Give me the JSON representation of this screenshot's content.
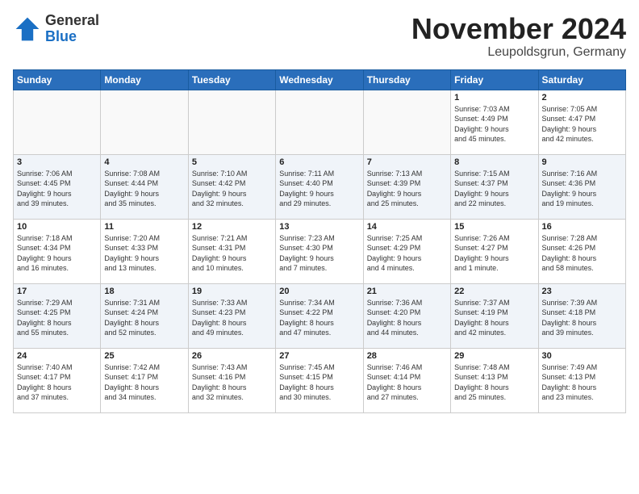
{
  "header": {
    "logo_general": "General",
    "logo_blue": "Blue",
    "month_title": "November 2024",
    "location": "Leupoldsgrun, Germany"
  },
  "calendar": {
    "days_of_week": [
      "Sunday",
      "Monday",
      "Tuesday",
      "Wednesday",
      "Thursday",
      "Friday",
      "Saturday"
    ],
    "weeks": [
      [
        {
          "day": "",
          "info": ""
        },
        {
          "day": "",
          "info": ""
        },
        {
          "day": "",
          "info": ""
        },
        {
          "day": "",
          "info": ""
        },
        {
          "day": "",
          "info": ""
        },
        {
          "day": "1",
          "info": "Sunrise: 7:03 AM\nSunset: 4:49 PM\nDaylight: 9 hours\nand 45 minutes."
        },
        {
          "day": "2",
          "info": "Sunrise: 7:05 AM\nSunset: 4:47 PM\nDaylight: 9 hours\nand 42 minutes."
        }
      ],
      [
        {
          "day": "3",
          "info": "Sunrise: 7:06 AM\nSunset: 4:45 PM\nDaylight: 9 hours\nand 39 minutes."
        },
        {
          "day": "4",
          "info": "Sunrise: 7:08 AM\nSunset: 4:44 PM\nDaylight: 9 hours\nand 35 minutes."
        },
        {
          "day": "5",
          "info": "Sunrise: 7:10 AM\nSunset: 4:42 PM\nDaylight: 9 hours\nand 32 minutes."
        },
        {
          "day": "6",
          "info": "Sunrise: 7:11 AM\nSunset: 4:40 PM\nDaylight: 9 hours\nand 29 minutes."
        },
        {
          "day": "7",
          "info": "Sunrise: 7:13 AM\nSunset: 4:39 PM\nDaylight: 9 hours\nand 25 minutes."
        },
        {
          "day": "8",
          "info": "Sunrise: 7:15 AM\nSunset: 4:37 PM\nDaylight: 9 hours\nand 22 minutes."
        },
        {
          "day": "9",
          "info": "Sunrise: 7:16 AM\nSunset: 4:36 PM\nDaylight: 9 hours\nand 19 minutes."
        }
      ],
      [
        {
          "day": "10",
          "info": "Sunrise: 7:18 AM\nSunset: 4:34 PM\nDaylight: 9 hours\nand 16 minutes."
        },
        {
          "day": "11",
          "info": "Sunrise: 7:20 AM\nSunset: 4:33 PM\nDaylight: 9 hours\nand 13 minutes."
        },
        {
          "day": "12",
          "info": "Sunrise: 7:21 AM\nSunset: 4:31 PM\nDaylight: 9 hours\nand 10 minutes."
        },
        {
          "day": "13",
          "info": "Sunrise: 7:23 AM\nSunset: 4:30 PM\nDaylight: 9 hours\nand 7 minutes."
        },
        {
          "day": "14",
          "info": "Sunrise: 7:25 AM\nSunset: 4:29 PM\nDaylight: 9 hours\nand 4 minutes."
        },
        {
          "day": "15",
          "info": "Sunrise: 7:26 AM\nSunset: 4:27 PM\nDaylight: 9 hours\nand 1 minute."
        },
        {
          "day": "16",
          "info": "Sunrise: 7:28 AM\nSunset: 4:26 PM\nDaylight: 8 hours\nand 58 minutes."
        }
      ],
      [
        {
          "day": "17",
          "info": "Sunrise: 7:29 AM\nSunset: 4:25 PM\nDaylight: 8 hours\nand 55 minutes."
        },
        {
          "day": "18",
          "info": "Sunrise: 7:31 AM\nSunset: 4:24 PM\nDaylight: 8 hours\nand 52 minutes."
        },
        {
          "day": "19",
          "info": "Sunrise: 7:33 AM\nSunset: 4:23 PM\nDaylight: 8 hours\nand 49 minutes."
        },
        {
          "day": "20",
          "info": "Sunrise: 7:34 AM\nSunset: 4:22 PM\nDaylight: 8 hours\nand 47 minutes."
        },
        {
          "day": "21",
          "info": "Sunrise: 7:36 AM\nSunset: 4:20 PM\nDaylight: 8 hours\nand 44 minutes."
        },
        {
          "day": "22",
          "info": "Sunrise: 7:37 AM\nSunset: 4:19 PM\nDaylight: 8 hours\nand 42 minutes."
        },
        {
          "day": "23",
          "info": "Sunrise: 7:39 AM\nSunset: 4:18 PM\nDaylight: 8 hours\nand 39 minutes."
        }
      ],
      [
        {
          "day": "24",
          "info": "Sunrise: 7:40 AM\nSunset: 4:17 PM\nDaylight: 8 hours\nand 37 minutes."
        },
        {
          "day": "25",
          "info": "Sunrise: 7:42 AM\nSunset: 4:17 PM\nDaylight: 8 hours\nand 34 minutes."
        },
        {
          "day": "26",
          "info": "Sunrise: 7:43 AM\nSunset: 4:16 PM\nDaylight: 8 hours\nand 32 minutes."
        },
        {
          "day": "27",
          "info": "Sunrise: 7:45 AM\nSunset: 4:15 PM\nDaylight: 8 hours\nand 30 minutes."
        },
        {
          "day": "28",
          "info": "Sunrise: 7:46 AM\nSunset: 4:14 PM\nDaylight: 8 hours\nand 27 minutes."
        },
        {
          "day": "29",
          "info": "Sunrise: 7:48 AM\nSunset: 4:13 PM\nDaylight: 8 hours\nand 25 minutes."
        },
        {
          "day": "30",
          "info": "Sunrise: 7:49 AM\nSunset: 4:13 PM\nDaylight: 8 hours\nand 23 minutes."
        }
      ]
    ]
  }
}
